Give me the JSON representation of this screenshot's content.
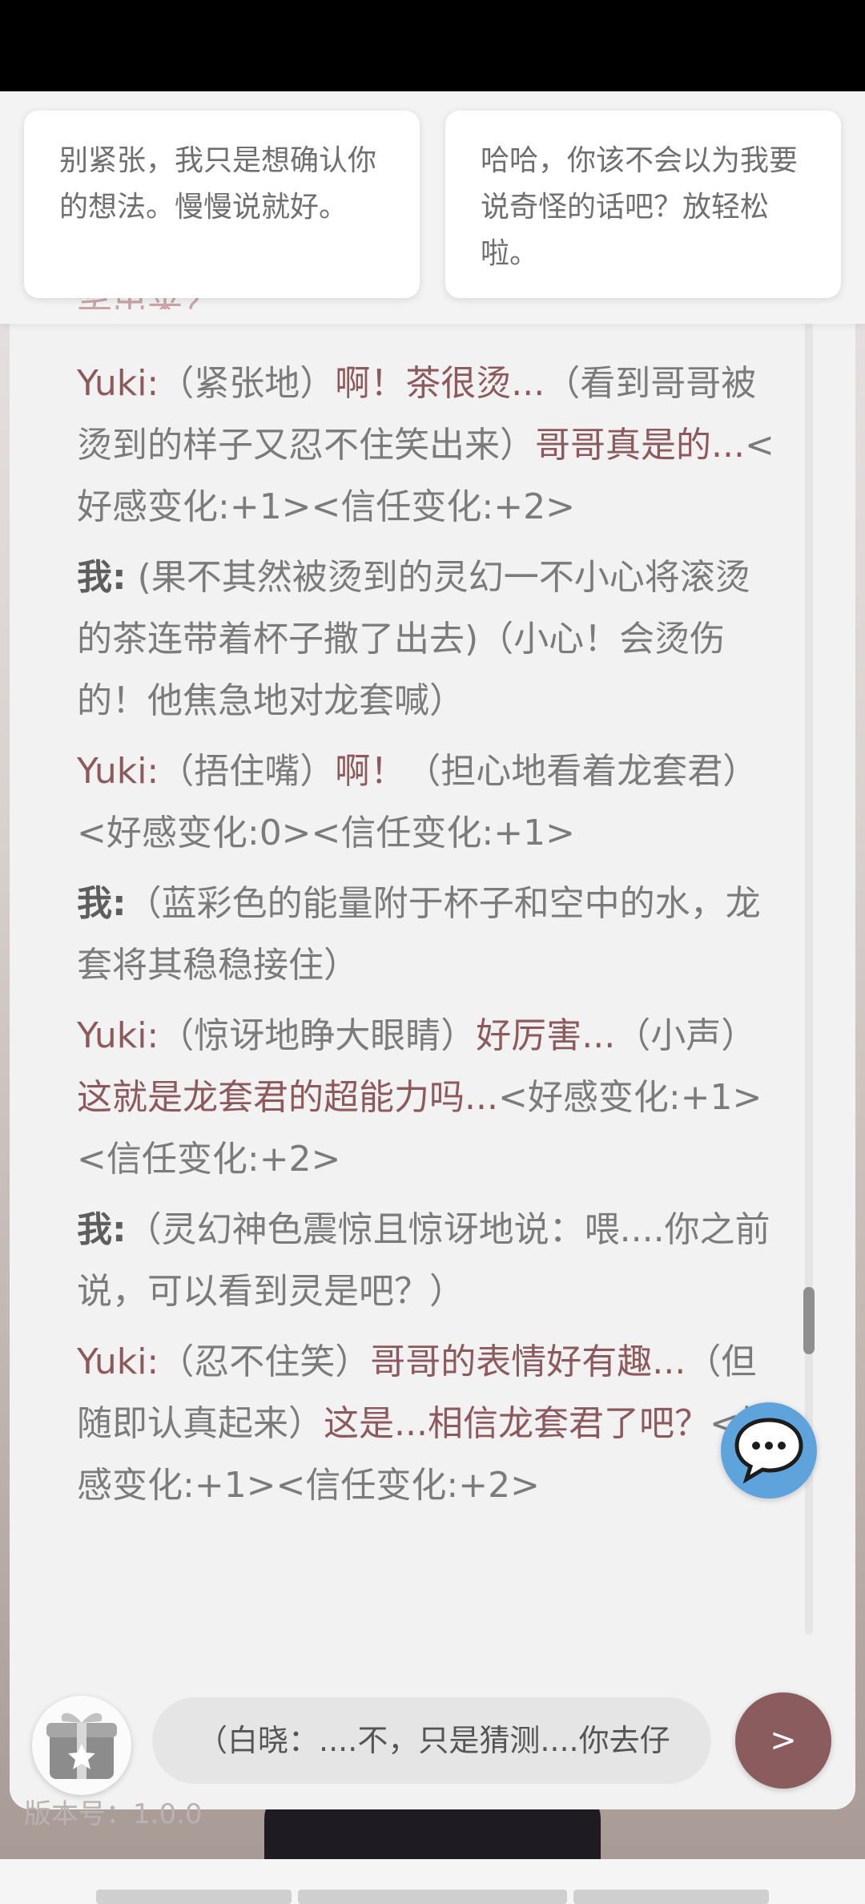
{
  "suggestions": [
    "别紧张，我只是想确认你的想法。慢慢说就好。",
    "哈哈，你该不会以为我要说奇怪的话吧？放轻松啦。"
  ],
  "cut_off_text": "笑出来？",
  "messages": [
    {
      "speaker": "Yuki",
      "segments": [
        {
          "kind": "narration",
          "text": "（紧张地）"
        },
        {
          "kind": "dialogue",
          "text": "啊！茶很烫..."
        },
        {
          "kind": "narration",
          "text": "（看到哥哥被烫到的样子又忍不住笑出来）"
        },
        {
          "kind": "dialogue",
          "text": "哥哥真是的..."
        },
        {
          "kind": "narration",
          "text": "<好感变化:+1><信任变化:+2>"
        }
      ]
    },
    {
      "speaker": "我",
      "segments": [
        {
          "kind": "narration",
          "text": " (果不其然被烫到的灵幻一不小心将滚烫的茶连带着杯子撒了出去)（小心！会烫伤的！他焦急地对龙套喊）"
        }
      ]
    },
    {
      "speaker": "Yuki",
      "segments": [
        {
          "kind": "narration",
          "text": "（捂住嘴）"
        },
        {
          "kind": "dialogue",
          "text": "啊！"
        },
        {
          "kind": "narration",
          "text": "（担心地看着龙套君）<好感变化:0><信任变化:+1>"
        }
      ]
    },
    {
      "speaker": "我",
      "segments": [
        {
          "kind": "narration",
          "text": "（蓝彩色的能量附于杯子和空中的水，龙套将其稳稳接住）"
        }
      ]
    },
    {
      "speaker": "Yuki",
      "segments": [
        {
          "kind": "narration",
          "text": "（惊讶地睁大眼睛）"
        },
        {
          "kind": "dialogue",
          "text": "好厉害..."
        },
        {
          "kind": "narration",
          "text": "（小声）"
        },
        {
          "kind": "dialogue",
          "text": "这就是龙套君的超能力吗..."
        },
        {
          "kind": "narration",
          "text": "<好感变化:+1><信任变化:+2>"
        }
      ]
    },
    {
      "speaker": "我",
      "segments": [
        {
          "kind": "narration",
          "text": "（灵幻神色震惊且惊讶地说：喂....你之前说，可以看到灵是吧？）"
        }
      ]
    },
    {
      "speaker": "Yuki",
      "segments": [
        {
          "kind": "narration",
          "text": "（忍不住笑）"
        },
        {
          "kind": "dialogue",
          "text": "哥哥的表情好有趣..."
        },
        {
          "kind": "narration",
          "text": "（但随即认真起来）"
        },
        {
          "kind": "dialogue",
          "text": "这是...相信龙套君了吧？"
        },
        {
          "kind": "narration",
          "text": "<好感变化:+1><信任变化:+2>"
        }
      ]
    }
  ],
  "input": {
    "value": "（白晓：....不，只是猜测....你去仔"
  },
  "send_label": ">",
  "version_label": "版本号：1.0.0",
  "icons": {
    "chat": "chat-bubble-icon",
    "gift": "gift-icon"
  },
  "colors": {
    "yuki": "#8c5a5c",
    "send": "#8b5c5d",
    "fab": "#5fa3dc"
  }
}
